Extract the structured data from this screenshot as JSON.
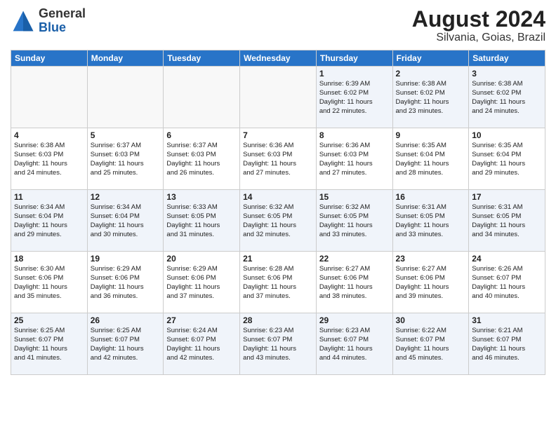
{
  "logo": {
    "general": "General",
    "blue": "Blue"
  },
  "title": {
    "month_year": "August 2024",
    "location": "Silvania, Goias, Brazil"
  },
  "days_of_week": [
    "Sunday",
    "Monday",
    "Tuesday",
    "Wednesday",
    "Thursday",
    "Friday",
    "Saturday"
  ],
  "weeks": [
    [
      {
        "day": "",
        "content": ""
      },
      {
        "day": "",
        "content": ""
      },
      {
        "day": "",
        "content": ""
      },
      {
        "day": "",
        "content": ""
      },
      {
        "day": "1",
        "content": "Sunrise: 6:39 AM\nSunset: 6:02 PM\nDaylight: 11 hours\nand 22 minutes."
      },
      {
        "day": "2",
        "content": "Sunrise: 6:38 AM\nSunset: 6:02 PM\nDaylight: 11 hours\nand 23 minutes."
      },
      {
        "day": "3",
        "content": "Sunrise: 6:38 AM\nSunset: 6:02 PM\nDaylight: 11 hours\nand 24 minutes."
      }
    ],
    [
      {
        "day": "4",
        "content": "Sunrise: 6:38 AM\nSunset: 6:03 PM\nDaylight: 11 hours\nand 24 minutes."
      },
      {
        "day": "5",
        "content": "Sunrise: 6:37 AM\nSunset: 6:03 PM\nDaylight: 11 hours\nand 25 minutes."
      },
      {
        "day": "6",
        "content": "Sunrise: 6:37 AM\nSunset: 6:03 PM\nDaylight: 11 hours\nand 26 minutes."
      },
      {
        "day": "7",
        "content": "Sunrise: 6:36 AM\nSunset: 6:03 PM\nDaylight: 11 hours\nand 27 minutes."
      },
      {
        "day": "8",
        "content": "Sunrise: 6:36 AM\nSunset: 6:03 PM\nDaylight: 11 hours\nand 27 minutes."
      },
      {
        "day": "9",
        "content": "Sunrise: 6:35 AM\nSunset: 6:04 PM\nDaylight: 11 hours\nand 28 minutes."
      },
      {
        "day": "10",
        "content": "Sunrise: 6:35 AM\nSunset: 6:04 PM\nDaylight: 11 hours\nand 29 minutes."
      }
    ],
    [
      {
        "day": "11",
        "content": "Sunrise: 6:34 AM\nSunset: 6:04 PM\nDaylight: 11 hours\nand 29 minutes."
      },
      {
        "day": "12",
        "content": "Sunrise: 6:34 AM\nSunset: 6:04 PM\nDaylight: 11 hours\nand 30 minutes."
      },
      {
        "day": "13",
        "content": "Sunrise: 6:33 AM\nSunset: 6:05 PM\nDaylight: 11 hours\nand 31 minutes."
      },
      {
        "day": "14",
        "content": "Sunrise: 6:32 AM\nSunset: 6:05 PM\nDaylight: 11 hours\nand 32 minutes."
      },
      {
        "day": "15",
        "content": "Sunrise: 6:32 AM\nSunset: 6:05 PM\nDaylight: 11 hours\nand 33 minutes."
      },
      {
        "day": "16",
        "content": "Sunrise: 6:31 AM\nSunset: 6:05 PM\nDaylight: 11 hours\nand 33 minutes."
      },
      {
        "day": "17",
        "content": "Sunrise: 6:31 AM\nSunset: 6:05 PM\nDaylight: 11 hours\nand 34 minutes."
      }
    ],
    [
      {
        "day": "18",
        "content": "Sunrise: 6:30 AM\nSunset: 6:06 PM\nDaylight: 11 hours\nand 35 minutes."
      },
      {
        "day": "19",
        "content": "Sunrise: 6:29 AM\nSunset: 6:06 PM\nDaylight: 11 hours\nand 36 minutes."
      },
      {
        "day": "20",
        "content": "Sunrise: 6:29 AM\nSunset: 6:06 PM\nDaylight: 11 hours\nand 37 minutes."
      },
      {
        "day": "21",
        "content": "Sunrise: 6:28 AM\nSunset: 6:06 PM\nDaylight: 11 hours\nand 37 minutes."
      },
      {
        "day": "22",
        "content": "Sunrise: 6:27 AM\nSunset: 6:06 PM\nDaylight: 11 hours\nand 38 minutes."
      },
      {
        "day": "23",
        "content": "Sunrise: 6:27 AM\nSunset: 6:06 PM\nDaylight: 11 hours\nand 39 minutes."
      },
      {
        "day": "24",
        "content": "Sunrise: 6:26 AM\nSunset: 6:07 PM\nDaylight: 11 hours\nand 40 minutes."
      }
    ],
    [
      {
        "day": "25",
        "content": "Sunrise: 6:25 AM\nSunset: 6:07 PM\nDaylight: 11 hours\nand 41 minutes."
      },
      {
        "day": "26",
        "content": "Sunrise: 6:25 AM\nSunset: 6:07 PM\nDaylight: 11 hours\nand 42 minutes."
      },
      {
        "day": "27",
        "content": "Sunrise: 6:24 AM\nSunset: 6:07 PM\nDaylight: 11 hours\nand 42 minutes."
      },
      {
        "day": "28",
        "content": "Sunrise: 6:23 AM\nSunset: 6:07 PM\nDaylight: 11 hours\nand 43 minutes."
      },
      {
        "day": "29",
        "content": "Sunrise: 6:23 AM\nSunset: 6:07 PM\nDaylight: 11 hours\nand 44 minutes."
      },
      {
        "day": "30",
        "content": "Sunrise: 6:22 AM\nSunset: 6:07 PM\nDaylight: 11 hours\nand 45 minutes."
      },
      {
        "day": "31",
        "content": "Sunrise: 6:21 AM\nSunset: 6:07 PM\nDaylight: 11 hours\nand 46 minutes."
      }
    ]
  ]
}
